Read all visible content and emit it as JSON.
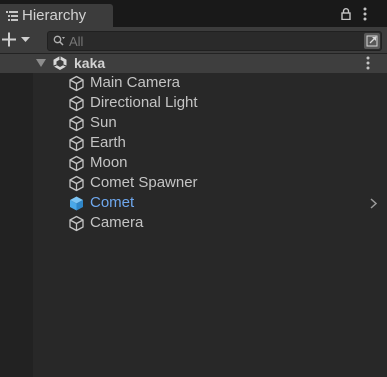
{
  "panel": {
    "tab_label": "Hierarchy",
    "icons": {
      "tab": "hierarchy-list-icon",
      "lock": "lock-icon",
      "menu": "kebab-menu-icon"
    }
  },
  "toolbar": {
    "add_button": {
      "icon": "plus-icon",
      "has_dropdown": true
    },
    "search": {
      "placeholder": "All",
      "value": ""
    }
  },
  "scene": {
    "name": "kaka",
    "expanded": true,
    "icon": "unity-scene-icon"
  },
  "objects": [
    {
      "label": "Main Camera",
      "icon": "gameobject-cube-icon"
    },
    {
      "label": "Directional Light",
      "icon": "gameobject-cube-icon"
    },
    {
      "label": "Sun",
      "icon": "gameobject-cube-icon"
    },
    {
      "label": "Earth",
      "icon": "gameobject-cube-icon"
    },
    {
      "label": "Moon",
      "icon": "gameobject-cube-icon"
    },
    {
      "label": "Comet Spawner",
      "icon": "gameobject-cube-icon"
    },
    {
      "label": "Comet",
      "icon": "prefab-cube-icon",
      "is_prefab": true,
      "has_children": true
    },
    {
      "label": "Camera",
      "icon": "gameobject-cube-icon"
    }
  ],
  "colors": {
    "background": "#282828",
    "tab": "#3c3c3c",
    "toolbar": "#3c3c3c",
    "scene_row": "#3e3e3e",
    "text": "#c4c4c4",
    "prefab_text": "#6fa8ee",
    "prefab_icon": "#4aa8e8"
  }
}
